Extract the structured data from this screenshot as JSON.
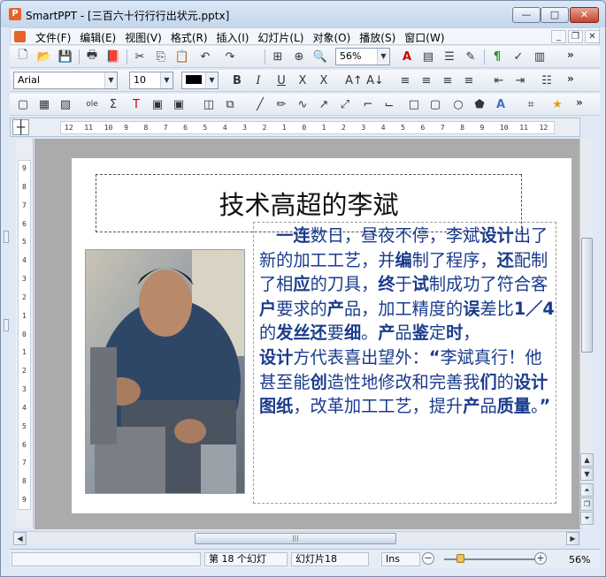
{
  "titlebar": {
    "app_name": "SmartPPT - [三百六十行行行出状元.pptx]",
    "minimize": "—",
    "maximize": "□",
    "close": "✕"
  },
  "menubar": {
    "items": [
      "文件(F)",
      "编辑(E)",
      "视图(V)",
      "格式(R)",
      "插入(I)",
      "幻灯片(L)",
      "对象(O)",
      "播放(S)",
      "窗口(W)"
    ],
    "mdi_min": "_",
    "mdi_restore": "❐",
    "mdi_close": "✕"
  },
  "toolbar": {
    "zoom_value": "56%",
    "font_name": "Arial",
    "font_size": "10",
    "more": "»"
  },
  "ruler": {
    "h_ticks": [
      "12",
      "11",
      "10",
      "9",
      "8",
      "7",
      "6",
      "5",
      "4",
      "3",
      "2",
      "1",
      "0",
      "1",
      "2",
      "3",
      "4",
      "5",
      "6",
      "7",
      "8",
      "9",
      "10",
      "11",
      "12"
    ],
    "v_ticks": [
      "9",
      "8",
      "7",
      "6",
      "5",
      "4",
      "3",
      "2",
      "1",
      "0",
      "1",
      "2",
      "3",
      "4",
      "5",
      "6",
      "7",
      "8",
      "9"
    ]
  },
  "slide": {
    "title": "技术高超的李斌",
    "body_p1_segments": [
      {
        "t": "　",
        "b": false
      },
      {
        "t": "一连",
        "b": true
      },
      {
        "t": "数日，昼夜不停，李斌",
        "b": false
      },
      {
        "t": "设计",
        "b": true
      },
      {
        "t": "出了新的加工工艺，并",
        "b": false
      },
      {
        "t": "编",
        "b": true
      },
      {
        "t": "制了程序，",
        "b": false
      },
      {
        "t": "还",
        "b": true
      },
      {
        "t": "配制了相",
        "b": false
      },
      {
        "t": "应",
        "b": true
      },
      {
        "t": "的刀具，",
        "b": false
      },
      {
        "t": "终",
        "b": true
      },
      {
        "t": "于",
        "b": false
      },
      {
        "t": "试",
        "b": true
      },
      {
        "t": "制成功了符合客",
        "b": false
      },
      {
        "t": "户",
        "b": true
      },
      {
        "t": "要求的",
        "b": false
      },
      {
        "t": "产",
        "b": true
      },
      {
        "t": "品，加工精度的",
        "b": false
      },
      {
        "t": "误",
        "b": true
      },
      {
        "t": "差比",
        "b": false
      },
      {
        "t": "1／4",
        "b": true
      },
      {
        "t": "的",
        "b": false
      },
      {
        "t": "发丝还",
        "b": true
      },
      {
        "t": "要",
        "b": false
      },
      {
        "t": "细",
        "b": true
      },
      {
        "t": "。",
        "b": false
      },
      {
        "t": "产",
        "b": true
      },
      {
        "t": "品",
        "b": false
      },
      {
        "t": "鉴",
        "b": true
      },
      {
        "t": "定",
        "b": false
      },
      {
        "t": "时",
        "b": true
      },
      {
        "t": "，",
        "b": false
      }
    ],
    "body_p2_segments": [
      {
        "t": "设计",
        "b": true
      },
      {
        "t": "方代表喜出望外：",
        "b": false
      },
      {
        "t": "“",
        "b": true
      },
      {
        "t": "李斌真行！他甚至能",
        "b": false
      },
      {
        "t": "创",
        "b": true
      },
      {
        "t": "造性地修改和完善我",
        "b": false
      },
      {
        "t": "们",
        "b": true
      },
      {
        "t": "的",
        "b": false
      },
      {
        "t": "设计图纸",
        "b": true
      },
      {
        "t": "，改革加工工艺，提升",
        "b": false
      },
      {
        "t": "产",
        "b": true
      },
      {
        "t": "品",
        "b": false
      },
      {
        "t": "质量",
        "b": true
      },
      {
        "t": "。",
        "b": false
      },
      {
        "t": "”",
        "b": true
      }
    ]
  },
  "statusbar": {
    "slide_pos": "第 18 个幻灯",
    "slide_name": "幻灯片18",
    "mode": "Ins",
    "zoom": "56%"
  },
  "colors": {
    "body_text": "#1a3b8c",
    "accent_orange": "#e8632a"
  }
}
